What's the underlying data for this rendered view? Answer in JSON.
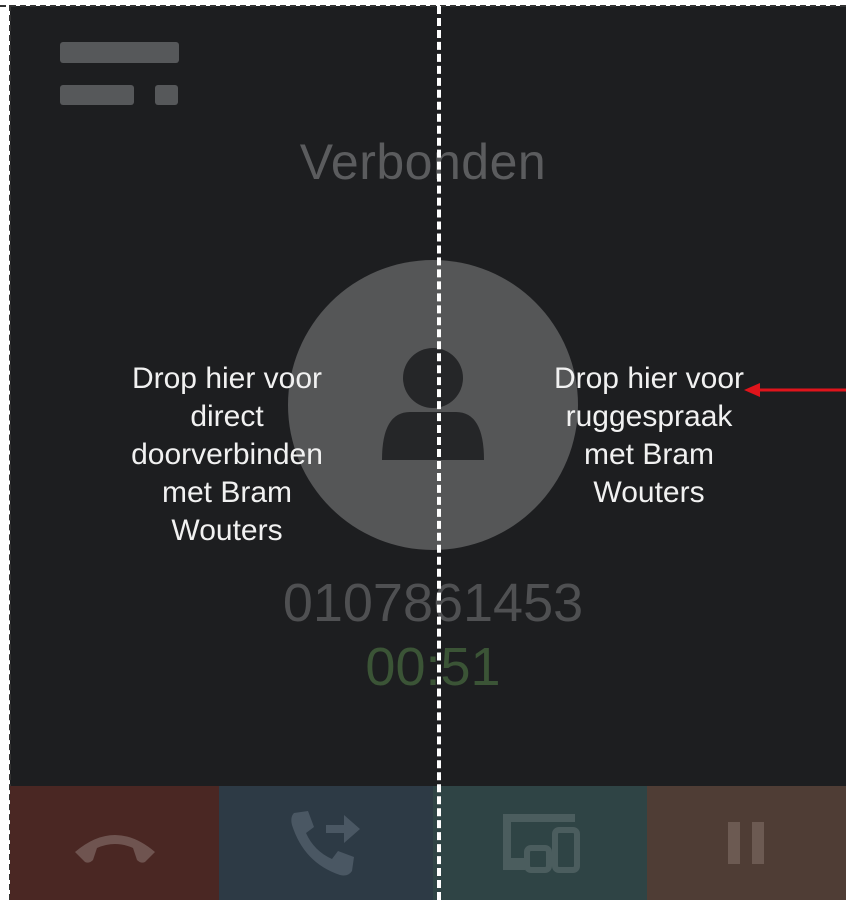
{
  "call": {
    "status": "Verbonden",
    "number": "0107861453",
    "duration": "00:51"
  },
  "drop_zones": {
    "left_label": "Drop hier voor direct doorverbinden met Bram Wouters",
    "right_label": "Drop hier voor ruggespraak met Bram Wouters"
  },
  "icons": {
    "menu": "menu-icon",
    "avatar": "person-icon",
    "hangup": "phone-hangup-icon",
    "transfer": "phone-forward-icon",
    "devices": "devices-icon",
    "hold": "pause-icon",
    "pointer": "arrow-left-icon"
  },
  "colors": {
    "background": "#1d1e20",
    "hangup": "#4a2723",
    "transfer": "#2d3a45",
    "devices": "#2f4445",
    "hold": "#4f3d35",
    "timer": "#3b5436",
    "arrow": "#e0141b"
  }
}
